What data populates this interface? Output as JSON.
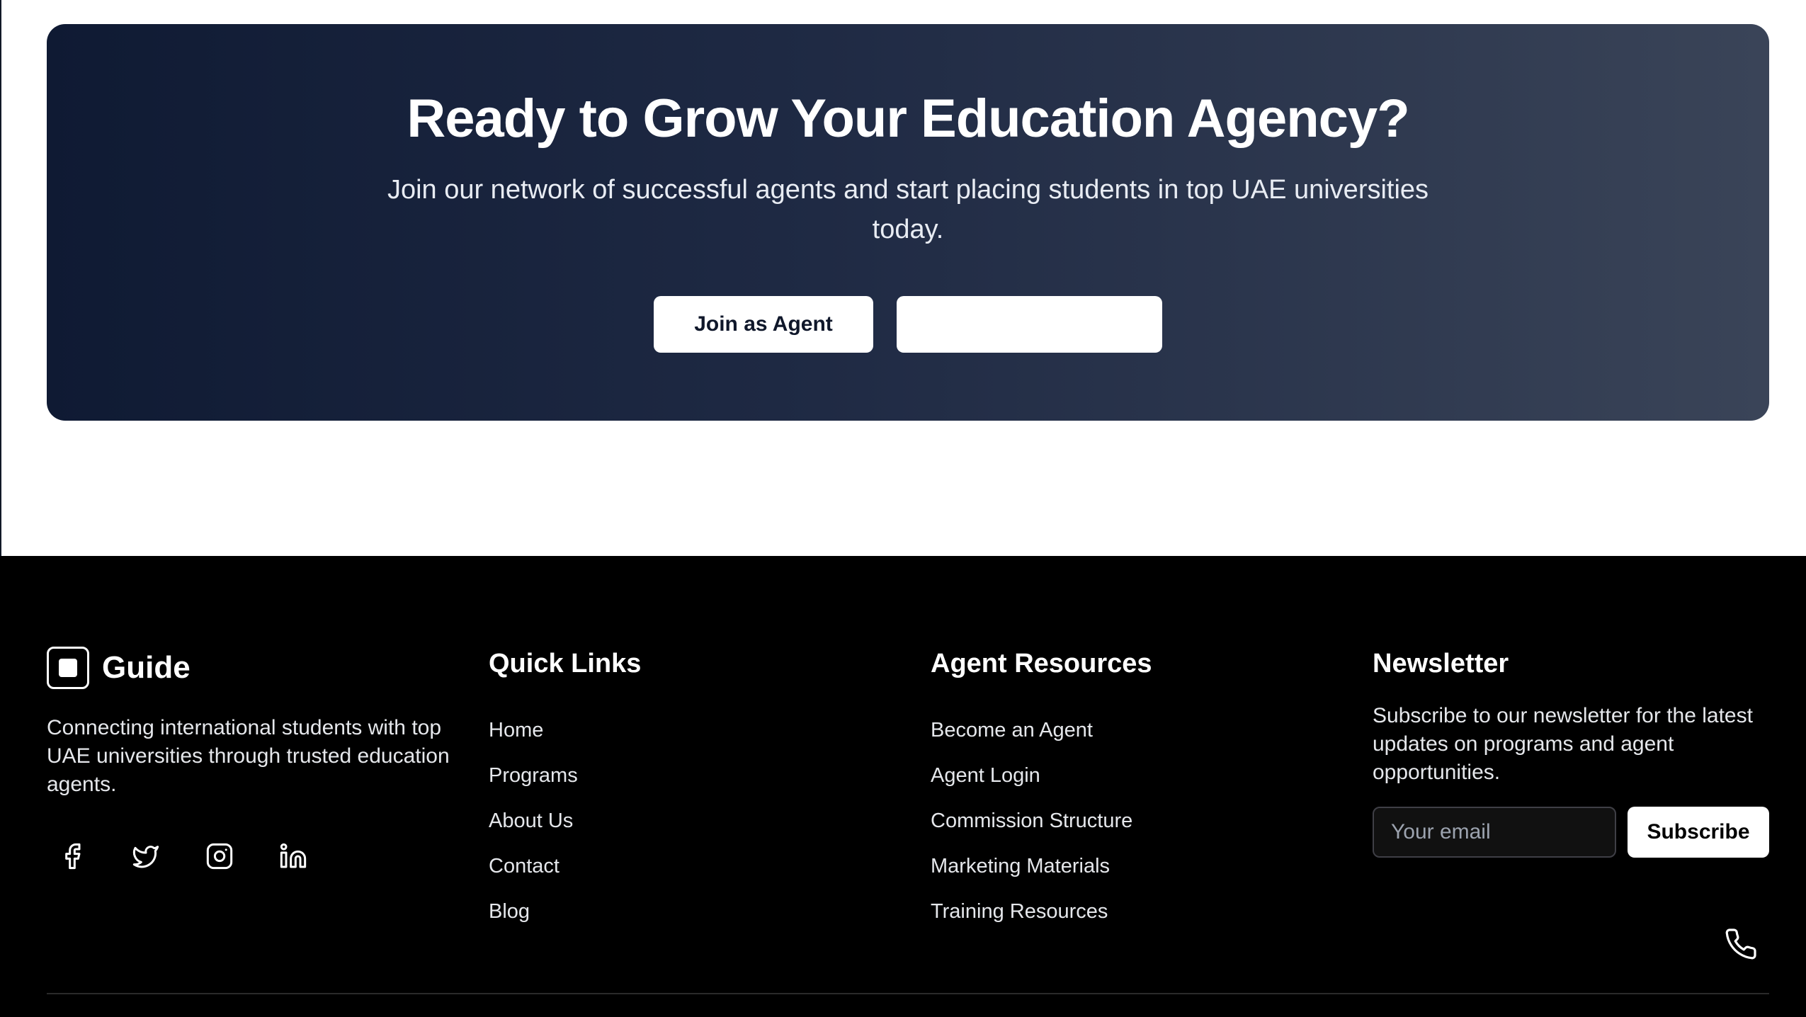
{
  "cta": {
    "title": "Ready to Grow Your Education Agency?",
    "subtitle": "Join our network of successful agents and start placing students in top UAE universities today.",
    "primary_button": "Join as Agent",
    "secondary_button": ""
  },
  "footer": {
    "brand_name": "Guide",
    "brand_description": "Connecting international students with top UAE universities through trusted education agents.",
    "social_icons": [
      "facebook-icon",
      "twitter-icon",
      "instagram-icon",
      "linkedin-icon"
    ],
    "quick_links": {
      "title": "Quick Links",
      "items": [
        "Home",
        "Programs",
        "About Us",
        "Contact",
        "Blog"
      ]
    },
    "agent_resources": {
      "title": "Agent Resources",
      "items": [
        "Become an Agent",
        "Agent Login",
        "Commission Structure",
        "Marketing Materials",
        "Training Resources"
      ]
    },
    "newsletter": {
      "title": "Newsletter",
      "description": "Subscribe to our newsletter for the latest updates on programs and agent opportunities.",
      "email_placeholder": "Your email",
      "subscribe_label": "Subscribe"
    },
    "phone_icon": "phone-icon"
  },
  "colors": {
    "cta_gradient_start": "#0f1a33",
    "cta_gradient_end": "#3a4458",
    "footer_bg": "#000000",
    "button_bg": "#ffffff"
  }
}
